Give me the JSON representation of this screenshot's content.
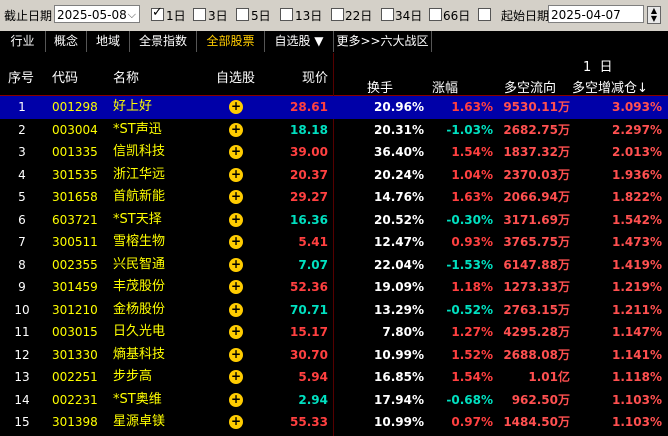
{
  "toolbar": {
    "end_date_label": "截止日期",
    "end_date_value": "2025-05-08",
    "periods": [
      {
        "label": "1日",
        "checked": true
      },
      {
        "label": "3日",
        "checked": false
      },
      {
        "label": "5日",
        "checked": false
      },
      {
        "label": "13日",
        "checked": false
      },
      {
        "label": "22日",
        "checked": false
      },
      {
        "label": "34日",
        "checked": false
      },
      {
        "label": "66日",
        "checked": false
      }
    ],
    "start_date_label": "起始日期",
    "start_date_value": "2025-04-07"
  },
  "tabs": [
    {
      "label": "行业"
    },
    {
      "label": "概念"
    },
    {
      "label": "地域"
    },
    {
      "label": "全景指数"
    },
    {
      "label": "全部股票",
      "active": true
    },
    {
      "label": "自选股 ▼"
    },
    {
      "label": "更多>>六大战区"
    }
  ],
  "header": {
    "idx": "序号",
    "code": "代码",
    "name": "名称",
    "fav": "自选股",
    "price": "现价",
    "period": "1  日",
    "turnover": "换手",
    "change": "涨幅",
    "flow": "多空流向",
    "ratio": "多空增减仓↓"
  },
  "rows": [
    {
      "idx": "1",
      "code": "001298",
      "name": "好上好",
      "price": "28.61",
      "price_dir": "up",
      "turnover": "20.96%",
      "change": "1.63%",
      "change_dir": "up",
      "flow": "9530.11万",
      "ratio": "3.093%"
    },
    {
      "idx": "2",
      "code": "003004",
      "name": "*ST声迅",
      "price": "18.18",
      "price_dir": "down",
      "turnover": "20.31%",
      "change": "-1.03%",
      "change_dir": "down",
      "flow": "2682.75万",
      "ratio": "2.297%"
    },
    {
      "idx": "3",
      "code": "001335",
      "name": "信凯科技",
      "price": "39.00",
      "price_dir": "up",
      "turnover": "36.40%",
      "change": "1.54%",
      "change_dir": "up",
      "flow": "1837.32万",
      "ratio": "2.013%"
    },
    {
      "idx": "4",
      "code": "301535",
      "name": "浙江华远",
      "price": "20.37",
      "price_dir": "up",
      "turnover": "20.24%",
      "change": "1.04%",
      "change_dir": "up",
      "flow": "2370.03万",
      "ratio": "1.936%"
    },
    {
      "idx": "5",
      "code": "301658",
      "name": "首航新能",
      "price": "29.27",
      "price_dir": "up",
      "turnover": "14.76%",
      "change": "1.63%",
      "change_dir": "up",
      "flow": "2066.94万",
      "ratio": "1.822%"
    },
    {
      "idx": "6",
      "code": "603721",
      "name": "*ST天择",
      "price": "16.36",
      "price_dir": "down",
      "turnover": "20.52%",
      "change": "-0.30%",
      "change_dir": "down",
      "flow": "3171.69万",
      "ratio": "1.542%"
    },
    {
      "idx": "7",
      "code": "300511",
      "name": "雪榕生物",
      "price": "5.41",
      "price_dir": "up",
      "turnover": "12.47%",
      "change": "0.93%",
      "change_dir": "up",
      "flow": "3765.75万",
      "ratio": "1.473%"
    },
    {
      "idx": "8",
      "code": "002355",
      "name": "兴民智通",
      "price": "7.07",
      "price_dir": "down",
      "turnover": "22.04%",
      "change": "-1.53%",
      "change_dir": "down",
      "flow": "6147.88万",
      "ratio": "1.419%"
    },
    {
      "idx": "9",
      "code": "301459",
      "name": "丰茂股份",
      "price": "52.36",
      "price_dir": "up",
      "turnover": "19.09%",
      "change": "1.18%",
      "change_dir": "up",
      "flow": "1273.33万",
      "ratio": "1.219%"
    },
    {
      "idx": "10",
      "code": "301210",
      "name": "金杨股份",
      "price": "70.71",
      "price_dir": "down",
      "turnover": "13.29%",
      "change": "-0.52%",
      "change_dir": "down",
      "flow": "2763.15万",
      "ratio": "1.211%"
    },
    {
      "idx": "11",
      "code": "003015",
      "name": "日久光电",
      "price": "15.17",
      "price_dir": "up",
      "turnover": "7.80%",
      "change": "1.27%",
      "change_dir": "up",
      "flow": "4295.28万",
      "ratio": "1.147%"
    },
    {
      "idx": "12",
      "code": "301330",
      "name": "熵基科技",
      "price": "30.70",
      "price_dir": "up",
      "turnover": "10.99%",
      "change": "1.52%",
      "change_dir": "up",
      "flow": "2688.08万",
      "ratio": "1.141%"
    },
    {
      "idx": "13",
      "code": "002251",
      "name": "步步高",
      "price": "5.94",
      "price_dir": "up",
      "turnover": "16.85%",
      "change": "1.54%",
      "change_dir": "up",
      "flow": "1.01亿",
      "ratio": "1.118%"
    },
    {
      "idx": "14",
      "code": "002231",
      "name": "*ST奥维",
      "price": "2.94",
      "price_dir": "down",
      "turnover": "17.94%",
      "change": "-0.68%",
      "change_dir": "down",
      "flow": "962.50万",
      "ratio": "1.103%"
    },
    {
      "idx": "15",
      "code": "301398",
      "name": "星源卓镁",
      "price": "55.33",
      "price_dir": "up",
      "turnover": "10.99%",
      "change": "0.97%",
      "change_dir": "up",
      "flow": "1484.50万",
      "ratio": "1.103%"
    }
  ],
  "selected_row": 0,
  "colors": {
    "up": "#ff4040",
    "down": "#00e0c0",
    "selection": "#0000a8",
    "code": "#ffff00"
  }
}
